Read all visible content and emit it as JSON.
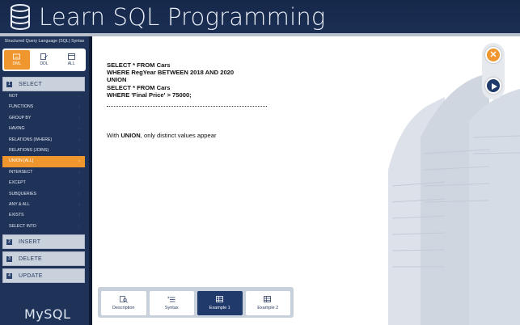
{
  "header": {
    "title": "Learn SQL Programming"
  },
  "sidebar": {
    "heading": "Structured Query Language (SQL) Syntax",
    "modes": [
      {
        "label": "DML",
        "active": true
      },
      {
        "label": "DDL",
        "active": false
      },
      {
        "label": "ALL",
        "active": false
      }
    ],
    "categories": [
      {
        "num": "1",
        "label": "SELECT"
      },
      {
        "num": "2",
        "label": "INSERT"
      },
      {
        "num": "3",
        "label": "DELETE"
      },
      {
        "num": "4",
        "label": "UPDATE"
      }
    ],
    "items": [
      "NOT",
      "FUNCTIONS",
      "GROUP BY",
      "HAVING",
      "RELATIONS (WHERE)",
      "RELATIONS (JOINS)",
      "UNION [ALL]",
      "INTERSECT",
      "EXCEPT",
      "SUBQUERIES",
      "ANY & ALL",
      "EXISTS",
      "SELECT INTO"
    ],
    "active_item": "UNION [ALL]",
    "footer": "MySQL"
  },
  "content": {
    "code_lines": [
      "SELECT * FROM Cars",
      "WHERE RegYear BETWEEN 2018 AND 2020",
      "UNION",
      "SELECT * FROM Cars",
      "WHERE 'Final Price' > 75000;"
    ],
    "note_prefix": "With ",
    "note_keyword": "UNION",
    "note_suffix": ", only distinct values appear"
  },
  "tabs": [
    {
      "label": "Description",
      "icon": "search-doc-icon",
      "active": false
    },
    {
      "label": "Syntax",
      "icon": "list-icon",
      "active": false
    },
    {
      "label": "Example 1",
      "icon": "table-icon",
      "active": true
    },
    {
      "label": "Example 2",
      "icon": "table-icon",
      "active": false
    }
  ],
  "colors": {
    "accent": "#f0962e",
    "navy": "#1f3358",
    "header": "#16284a"
  }
}
